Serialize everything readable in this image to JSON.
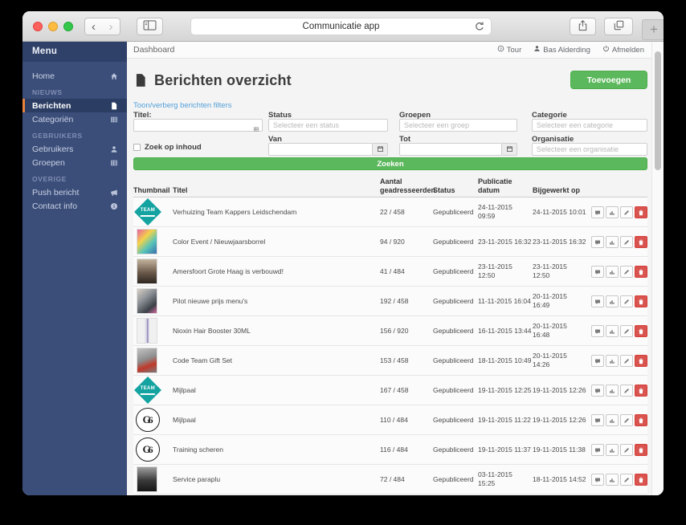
{
  "browser": {
    "url_text": "Communicatie app",
    "back_glyph": "‹",
    "forward_glyph": "›",
    "new_tab_glyph": "+"
  },
  "colors": {
    "sidebar_navy": "#3b4e7a",
    "active_orange": "#e8833b",
    "accent_green": "#5cb85c",
    "danger_red": "#d9534f",
    "link_blue": "#53a0d8"
  },
  "sidebar": {
    "title": "Menu",
    "sections": [
      {
        "label": "",
        "items": [
          {
            "label": "Home",
            "icon": "home",
            "active": false
          }
        ]
      },
      {
        "label": "NIEUWS",
        "items": [
          {
            "label": "Berichten",
            "icon": "file",
            "active": true
          },
          {
            "label": "Categoriën",
            "icon": "table",
            "active": false
          }
        ]
      },
      {
        "label": "GEBRUIKERS",
        "items": [
          {
            "label": "Gebruikers",
            "icon": "user",
            "active": false
          },
          {
            "label": "Groepen",
            "icon": "table",
            "active": false
          }
        ]
      },
      {
        "label": "OVERIGE",
        "items": [
          {
            "label": "Push bericht",
            "icon": "megaphone",
            "active": false
          },
          {
            "label": "Contact info",
            "icon": "info",
            "active": false
          }
        ]
      }
    ]
  },
  "topbar": {
    "breadcrumb": "Dashboard",
    "links": [
      {
        "label": "Tour",
        "icon": "question"
      },
      {
        "label": "Bas Alderding",
        "icon": "user"
      },
      {
        "label": "Afmelden",
        "icon": "power"
      }
    ]
  },
  "page": {
    "title": "Berichten overzicht",
    "add_button": "Toevoegen",
    "filter_toggle": "Toon/verberg berichten filters",
    "filters": {
      "titel_label": "Titel:",
      "status_label": "Status",
      "status_placeholder": "Selecteer een status",
      "groepen_label": "Groepen",
      "groepen_placeholder": "Selecteer een groep",
      "categorie_label": "Categorie",
      "categorie_placeholder": "Selecteer een categorie",
      "zoek_op_inhoud_label": "Zoek op inhoud",
      "van_label": "Van",
      "tot_label": "Tot",
      "organisatie_label": "Organisatie",
      "organisatie_placeholder": "Selecteer een organisatie",
      "search_button": "Zoeken"
    }
  },
  "table": {
    "headers": [
      "Thumbnail",
      "Titel",
      "Aantal geadresseerden",
      "Status",
      "Publicatie datum",
      "Bijgewerkt op",
      ""
    ],
    "actions": [
      {
        "name": "comment",
        "icon": "comment"
      },
      {
        "name": "stats",
        "icon": "chart"
      },
      {
        "name": "edit",
        "icon": "edit"
      },
      {
        "name": "delete",
        "icon": "delete"
      }
    ],
    "rows": [
      {
        "thumb": "team",
        "title": "Verhuizing Team Kappers Leidschendam",
        "aantal": "22 / 458",
        "status": "Gepubliceerd",
        "pub": "24-11-2015\n09:59",
        "upd": "24-11-2015 10:01"
      },
      {
        "thumb": "photo-hair",
        "title": "Color Event / Nieuwjaarsborrel",
        "aantal": "94 / 920",
        "status": "Gepubliceerd",
        "pub": "23-11-2015 16:32",
        "upd": "23-11-2015 16:32"
      },
      {
        "thumb": "photo-interior",
        "title": "Amersfoort Grote Haag is verbouwd!",
        "aantal": "41 / 484",
        "status": "Gepubliceerd",
        "pub": "23-11-2015\n12:50",
        "upd": "23-11-2015\n12:50"
      },
      {
        "thumb": "photo-phone",
        "title": "Pilot nieuwe prijs menu's",
        "aantal": "192 / 458",
        "status": "Gepubliceerd",
        "pub": "11-11-2015 16:04",
        "upd": "20-11-2015\n16:49"
      },
      {
        "thumb": "photo-bottle",
        "title": "Nioxin Hair Booster 30ML",
        "aantal": "156 / 920",
        "status": "Gepubliceerd",
        "pub": "16-11-2015 13:44",
        "upd": "20-11-2015\n16:48"
      },
      {
        "thumb": "photo-gift",
        "title": "Code Team Gift Set",
        "aantal": "153 / 458",
        "status": "Gepubliceerd",
        "pub": "18-11-2015 10:49",
        "upd": "20-11-2015\n14:26"
      },
      {
        "thumb": "team",
        "title": "Mijlpaal",
        "aantal": "167 / 458",
        "status": "Gepubliceerd",
        "pub": "19-11-2015 12:25",
        "upd": "19-11-2015 12:26"
      },
      {
        "thumb": "monogram",
        "title": "Mijlpaal",
        "aantal": "110 / 484",
        "status": "Gepubliceerd",
        "pub": "19-11-2015 11:22",
        "upd": "19-11-2015 12:26"
      },
      {
        "thumb": "monogram",
        "title": "Training scheren",
        "aantal": "116 / 484",
        "status": "Gepubliceerd",
        "pub": "19-11-2015 11:37",
        "upd": "19-11-2015 11:38"
      },
      {
        "thumb": "photo-umbrella",
        "title": "Service paraplu",
        "aantal": "72 / 484",
        "status": "Gepubliceerd",
        "pub": "03-11-2015\n15:25",
        "upd": "18-11-2015 14:52"
      }
    ]
  }
}
